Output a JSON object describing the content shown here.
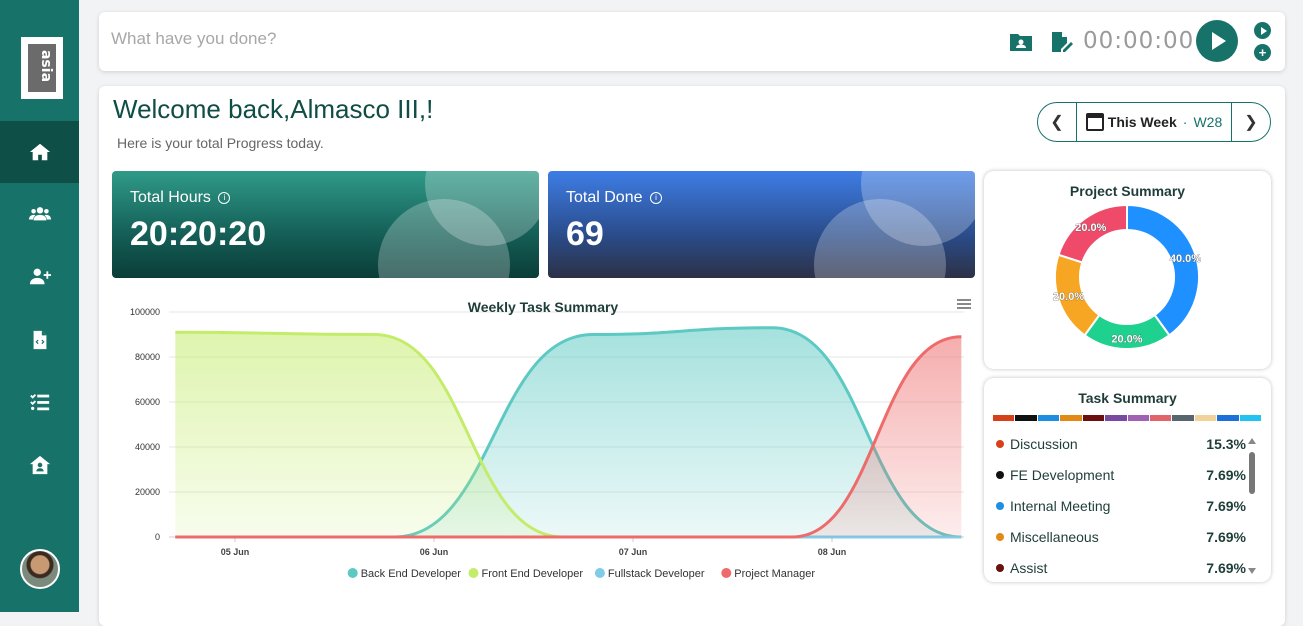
{
  "sidebar": {
    "logo_text": "asia",
    "nav": [
      {
        "icon": "home-icon"
      },
      {
        "icon": "users-icon"
      },
      {
        "icon": "user-plus-icon"
      },
      {
        "icon": "file-code-icon"
      },
      {
        "icon": "task-list-icon"
      },
      {
        "icon": "house-user-icon"
      }
    ]
  },
  "topbar": {
    "placeholder": "What have you done?",
    "timer": "00:00:00"
  },
  "main": {
    "welcome": "Welcome back,Almasco III,!",
    "subtitle": "Here is your total Progress today.",
    "week": {
      "label": "This Week",
      "separator": "·",
      "code": "W28"
    },
    "stats": [
      {
        "label": "Total Hours",
        "value": "20:20:20"
      },
      {
        "label": "Total Done",
        "value": "69"
      }
    ]
  },
  "chart_data": [
    {
      "type": "area",
      "title": "Weekly Task Summary",
      "x": [
        "05 Jun",
        "06 Jun",
        "07 Jun",
        "08 Jun"
      ],
      "y_ticks": [
        "100000",
        "80000",
        "60000",
        "40000",
        "20000",
        "0"
      ],
      "ylim": [
        0,
        100000
      ],
      "series": [
        {
          "name": "Back End Developer",
          "color": "#5cc9c3",
          "points": [
            [
              0,
              0
            ],
            [
              0.8,
              0
            ],
            [
              1.8,
              90000
            ],
            [
              2.7,
              93000
            ],
            [
              3.65,
              0
            ]
          ]
        },
        {
          "name": "Front End Developer",
          "color": "#c3ec6b",
          "points": [
            [
              -0.3,
              91000
            ],
            [
              0.7,
              90000
            ],
            [
              1.65,
              0
            ],
            [
              3.65,
              0
            ]
          ]
        },
        {
          "name": "Fullstack Developer",
          "color": "#7fcbe8",
          "points": [
            [
              -0.3,
              0
            ],
            [
              3.65,
              0
            ]
          ]
        },
        {
          "name": "Project Manager",
          "color": "#ee6b6b",
          "points": [
            [
              -0.3,
              0
            ],
            [
              2.8,
              0
            ],
            [
              3.65,
              89000
            ]
          ]
        }
      ],
      "legend_position": "bottom"
    },
    {
      "type": "pie",
      "title": "Project Summary",
      "slices": [
        {
          "label": "40.0%",
          "value": 40,
          "color": "#1e90ff"
        },
        {
          "label": "20.0%",
          "value": 20,
          "color": "#1ed18e"
        },
        {
          "label": "20.0%",
          "value": 20,
          "color": "#f6a623"
        },
        {
          "label": "20.0%",
          "value": 20,
          "color": "#f04a6a"
        }
      ]
    }
  ],
  "task_summary": {
    "title": "Task Summary",
    "colorbar": [
      "#d6401b",
      "#111111",
      "#1e8ee0",
      "#e18a16",
      "#6b0f0f",
      "#7a4aa0",
      "#a062b4",
      "#e0646a",
      "#56656e",
      "#f0d29a",
      "#1c70d8",
      "#22c3f0"
    ],
    "items": [
      {
        "name": "Discussion",
        "pct": "15.3%",
        "color": "#d6401b"
      },
      {
        "name": "FE Development",
        "pct": "7.69%",
        "color": "#111111"
      },
      {
        "name": "Internal Meeting",
        "pct": "7.69%",
        "color": "#1e8ee0"
      },
      {
        "name": "Miscellaneous",
        "pct": "7.69%",
        "color": "#e18a16"
      },
      {
        "name": "Assist",
        "pct": "7.69%",
        "color": "#6b0f0f"
      }
    ]
  }
}
